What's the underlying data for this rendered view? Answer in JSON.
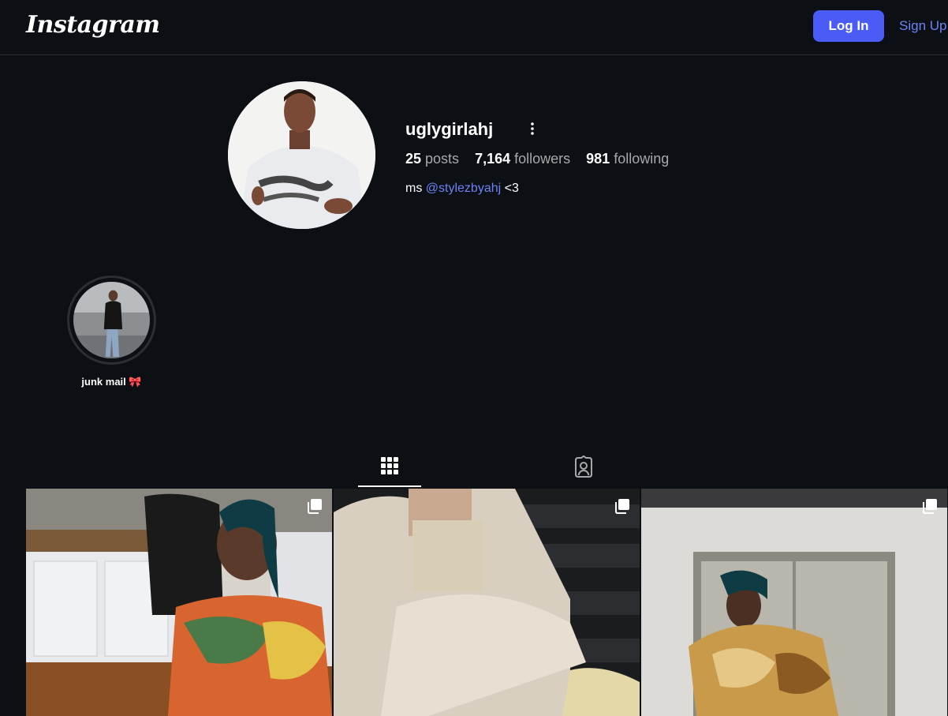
{
  "header": {
    "logo": "Instagram",
    "login_label": "Log In",
    "signup_label": "Sign Up"
  },
  "profile": {
    "username": "uglygirlahj",
    "posts_count": "25",
    "posts_label": "posts",
    "followers_count": "7,164",
    "followers_label": "followers",
    "following_count": "981",
    "following_label": "following",
    "bio_prefix": "ms",
    "bio_mention": "@stylezbyahj",
    "bio_suffix": "<3"
  },
  "highlights": [
    {
      "label": "junk mail 🎀"
    }
  ],
  "tabs": [
    {
      "icon": "grid-icon",
      "active": true
    },
    {
      "icon": "tagged-icon",
      "active": false
    }
  ],
  "posts": [
    {
      "icon": "multi-photo-icon"
    },
    {
      "icon": "multi-photo-icon"
    },
    {
      "icon": "multi-photo-icon"
    }
  ],
  "colors": {
    "background": "#0c0f14",
    "accent": "#4a5bf6",
    "link": "#6d83f5",
    "muted_text": "#a8a8a8"
  }
}
